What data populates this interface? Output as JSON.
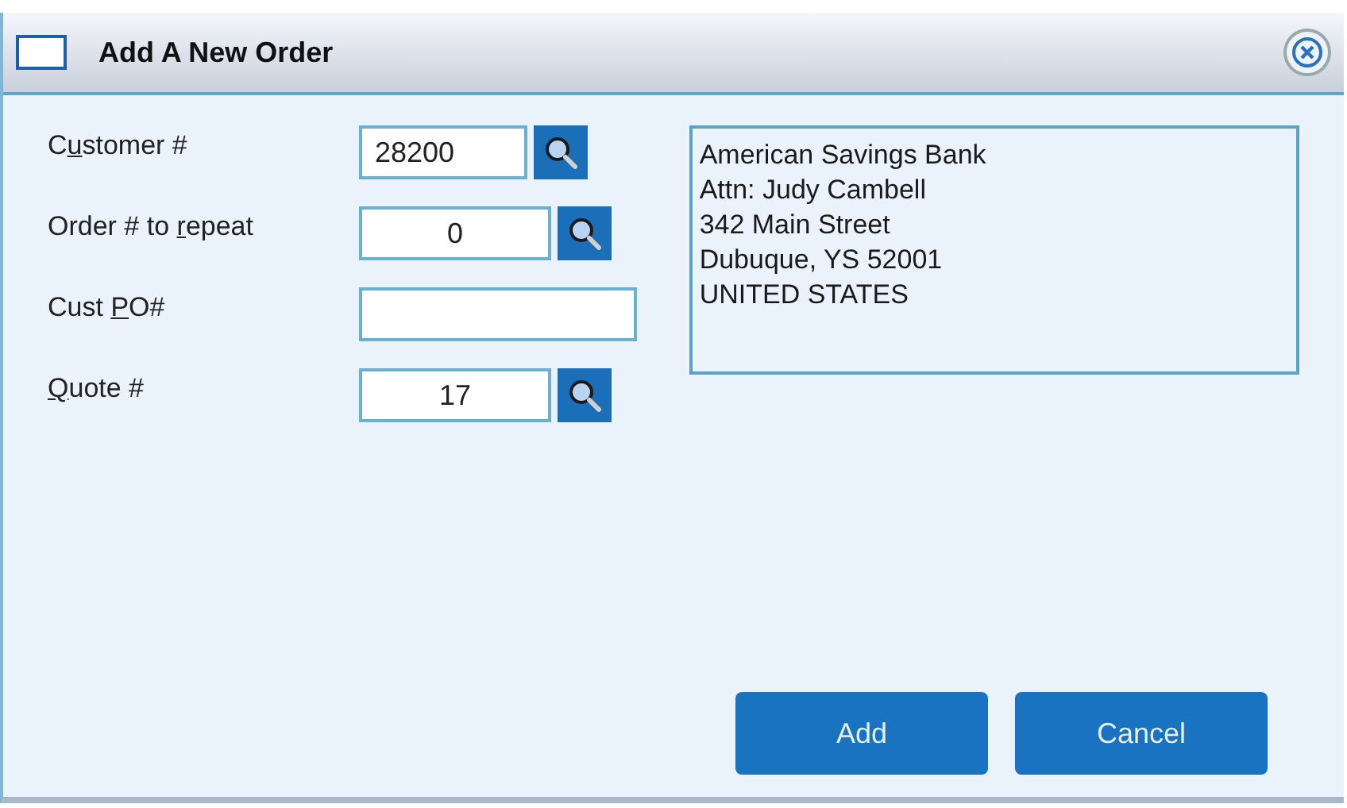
{
  "window": {
    "title": "Add A New Order"
  },
  "fields": [
    {
      "label": {
        "before": "C",
        "key": "u",
        "after": "stomer #"
      },
      "value": "28200",
      "lookup": true
    },
    {
      "label": {
        "before": "Order # to ",
        "key": "r",
        "after": "epeat"
      },
      "value": "0",
      "lookup": true
    },
    {
      "label": {
        "before": "Cust ",
        "key": "P",
        "after": "O#"
      },
      "lookup": false
    },
    {
      "label": {
        "key": "Q",
        "after": "uote #"
      },
      "value": "17",
      "lookup": true
    }
  ],
  "address": [
    "American Savings Bank",
    "Attn: Judy Cambell",
    "342 Main Street",
    "Dubuque, YS 52001",
    "UNITED STATES"
  ],
  "buttons": [
    "Add",
    "Cancel"
  ]
}
